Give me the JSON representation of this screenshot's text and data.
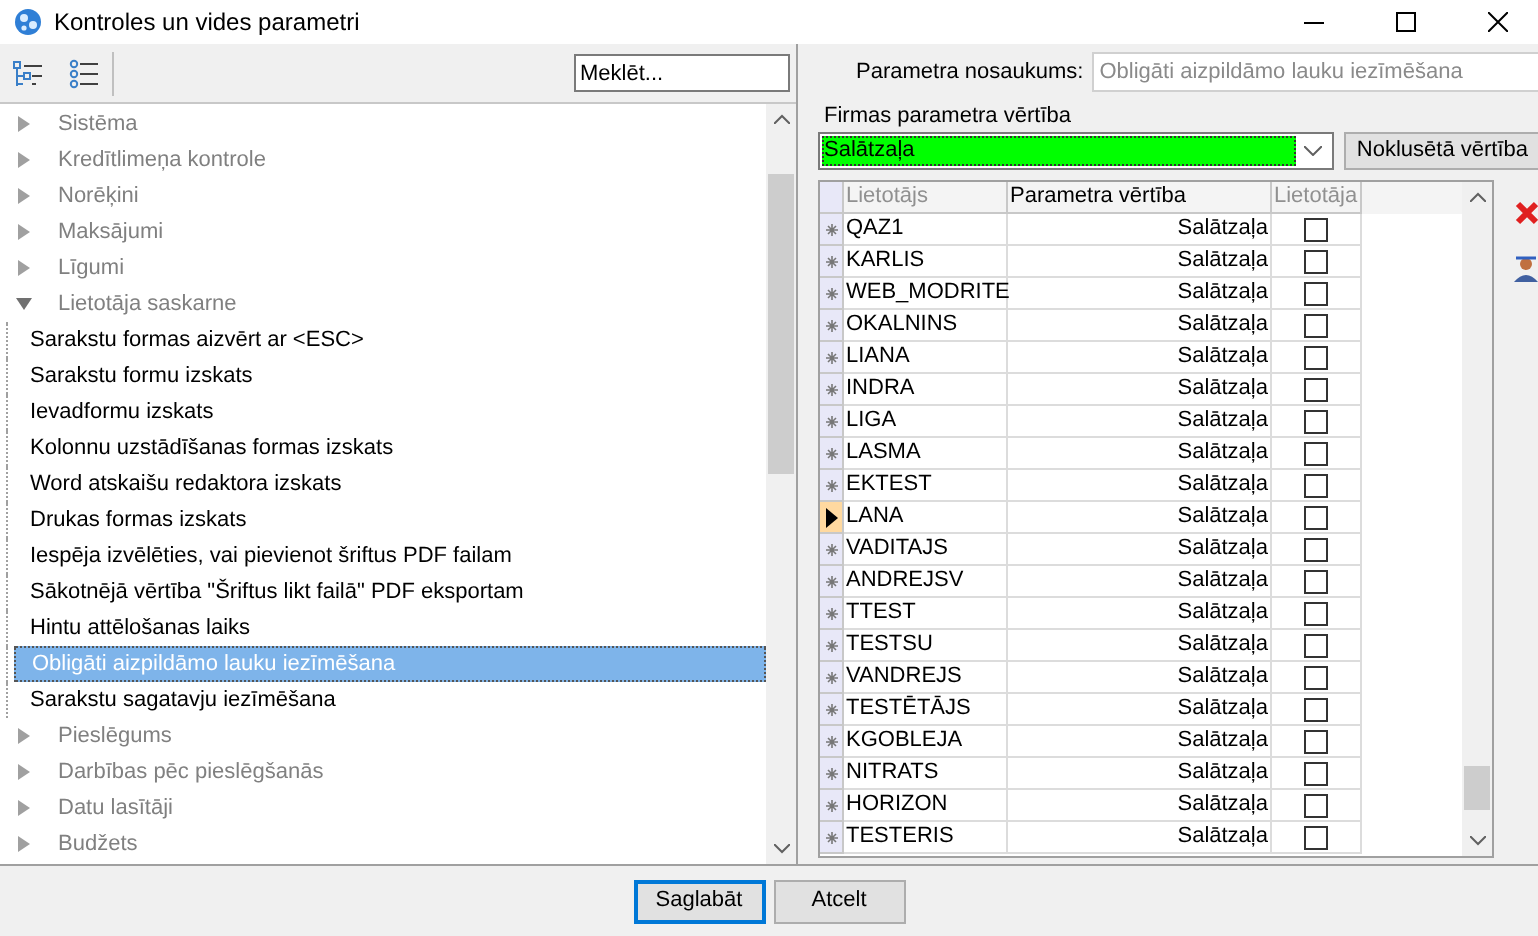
{
  "window": {
    "title": "Kontroles un vides parametri"
  },
  "search": {
    "placeholder": "Meklēt..."
  },
  "tree": [
    {
      "label": "Sistēma",
      "expanded": false
    },
    {
      "label": "Kredītlimeņa kontrole",
      "expanded": false
    },
    {
      "label": "Norēķini",
      "expanded": false
    },
    {
      "label": "Maksājumi",
      "expanded": false
    },
    {
      "label": "Līgumi",
      "expanded": false
    },
    {
      "label": "Lietotāja saskarne",
      "expanded": true,
      "children": [
        {
          "label": "Sarakstu formas aizvērt ar <ESC>",
          "selected": false
        },
        {
          "label": "Sarakstu formu izskats",
          "selected": false
        },
        {
          "label": "Ievadformu izskats",
          "selected": false
        },
        {
          "label": "Kolonnu uzstādīšanas formas izskats",
          "selected": false
        },
        {
          "label": "Word atskaišu redaktora izskats",
          "selected": false
        },
        {
          "label": "Drukas formas izskats",
          "selected": false
        },
        {
          "label": "Iespēja izvēlēties, vai pievienot šriftus PDF failam",
          "selected": false
        },
        {
          "label": "Sākotnējā vērtība \"Šriftus likt failā\" PDF eksportam",
          "selected": false
        },
        {
          "label": "Hintu attēlošanas laiks",
          "selected": false
        },
        {
          "label": "Obligāti aizpildāmo lauku iezīmēšana",
          "selected": true
        },
        {
          "label": "Sarakstu sagatavju iezīmēšana",
          "selected": false
        }
      ]
    },
    {
      "label": "Pieslēgums",
      "expanded": false
    },
    {
      "label": "Darbības pēc pieslēgšanās",
      "expanded": false
    },
    {
      "label": "Datu lasītāji",
      "expanded": false
    },
    {
      "label": "Budžets",
      "expanded": false
    }
  ],
  "param": {
    "label": "Parametra nosaukums:",
    "value": "Obligāti aizpildāmo lauku iezīmēšana"
  },
  "firm_value": {
    "label": "Firmas parametra vērtība",
    "value": "Salātzaļa",
    "color": "#00ff00"
  },
  "default_button": "Noklusētā vērtība",
  "grid": {
    "columns": [
      "Lietotājs",
      "Parametra vērtība",
      "Lietotāja"
    ],
    "rows": [
      {
        "user": "QAZ1",
        "value": "Salātzaļa",
        "checked": false,
        "current": false
      },
      {
        "user": "KARLIS",
        "value": "Salātzaļa",
        "checked": false,
        "current": false
      },
      {
        "user": "WEB_MODRITE",
        "value": "Salātzaļa",
        "checked": false,
        "current": false
      },
      {
        "user": "OKALNINS",
        "value": "Salātzaļa",
        "checked": false,
        "current": false
      },
      {
        "user": "LIANA",
        "value": "Salātzaļa",
        "checked": false,
        "current": false
      },
      {
        "user": "INDRA",
        "value": "Salātzaļa",
        "checked": false,
        "current": false
      },
      {
        "user": "LIGA",
        "value": "Salātzaļa",
        "checked": false,
        "current": false
      },
      {
        "user": "LASMA",
        "value": "Salātzaļa",
        "checked": false,
        "current": false
      },
      {
        "user": "EKTEST",
        "value": "Salātzaļa",
        "checked": false,
        "current": false
      },
      {
        "user": "LANA",
        "value": "Salātzaļa",
        "checked": false,
        "current": true
      },
      {
        "user": "VADITAJS",
        "value": "Salātzaļa",
        "checked": false,
        "current": false
      },
      {
        "user": "ANDREJSV",
        "value": "Salātzaļa",
        "checked": false,
        "current": false
      },
      {
        "user": "TTEST",
        "value": "Salātzaļa",
        "checked": false,
        "current": false
      },
      {
        "user": "TESTSU",
        "value": "Salātzaļa",
        "checked": false,
        "current": false
      },
      {
        "user": "VANDREJS",
        "value": "Salātzaļa",
        "checked": false,
        "current": false
      },
      {
        "user": "TESTĒTĀJS",
        "value": "Salātzaļa",
        "checked": false,
        "current": false
      },
      {
        "user": "KGOBLEJA",
        "value": "Salātzaļa",
        "checked": false,
        "current": false
      },
      {
        "user": "NITRATS",
        "value": "Salātzaļa",
        "checked": false,
        "current": false
      },
      {
        "user": "HORIZON",
        "value": "Salātzaļa",
        "checked": false,
        "current": false
      },
      {
        "user": "TESTERIS",
        "value": "Salātzaļa",
        "checked": false,
        "current": false
      }
    ]
  },
  "buttons": [
    "Saglabāt",
    "Atcelt"
  ]
}
